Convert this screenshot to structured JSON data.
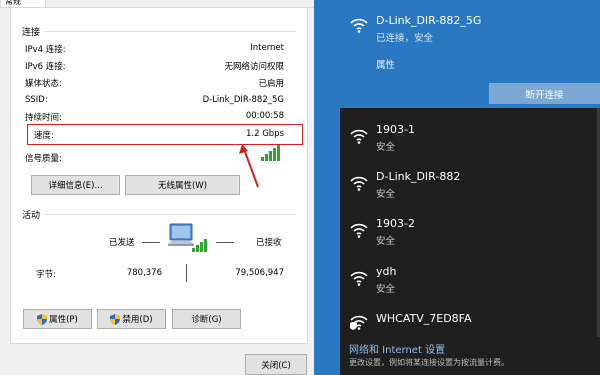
{
  "dialog": {
    "tab_label": "常规",
    "connection_title": "连接",
    "rows": [
      {
        "label": "IPv4 连接:",
        "value": "Internet"
      },
      {
        "label": "IPv6 连接:",
        "value": "无网络访问权限"
      },
      {
        "label": "媒体状态:",
        "value": "已启用"
      },
      {
        "label": "SSID:",
        "value": "D-Link_DIR-882_5G"
      },
      {
        "label": "持续时间:",
        "value": "00:00:58"
      },
      {
        "label": "速度:",
        "value": "1.2 Gbps"
      }
    ],
    "signal_label": "信号质量:",
    "signal_level": 5,
    "details_button": "详细信息(E)...",
    "wireless_props_button": "无线属性(W)",
    "activity_title": "活动",
    "sent_label": "已发送",
    "received_label": "已接收",
    "bytes_label": "字节:",
    "bytes_sent": "780,376",
    "bytes_received": "79,506,947",
    "properties_button": "属性(P)",
    "disable_button": "禁用(D)",
    "diagnose_button": "诊断(G)",
    "close_button": "关闭(C)"
  },
  "flyout": {
    "active_network": {
      "name": "D-Link_DIR-882_5G",
      "status": "已连接，安全",
      "properties_link": "属性",
      "disconnect_button": "断开连接"
    },
    "networks": [
      {
        "name": "1903-1",
        "status": "安全",
        "icon": "wifi-icon"
      },
      {
        "name": "D-Link_DIR-882",
        "status": "安全",
        "icon": "wifi-icon"
      },
      {
        "name": "1903-2",
        "status": "安全",
        "icon": "wifi-icon"
      },
      {
        "name": "ydh",
        "status": "安全",
        "icon": "wifi-icon"
      },
      {
        "name": "WHCATV_7ED8FA",
        "status": "",
        "icon": "wifi-shield-icon"
      }
    ],
    "settings_link": "网络和 Internet 设置",
    "settings_desc": "更改设置，例如将某连接设置为按流量计费。"
  },
  "colors": {
    "accent": "#2b78c2",
    "highlight_box": "#d42020",
    "signal_green": "#2fa32f"
  }
}
